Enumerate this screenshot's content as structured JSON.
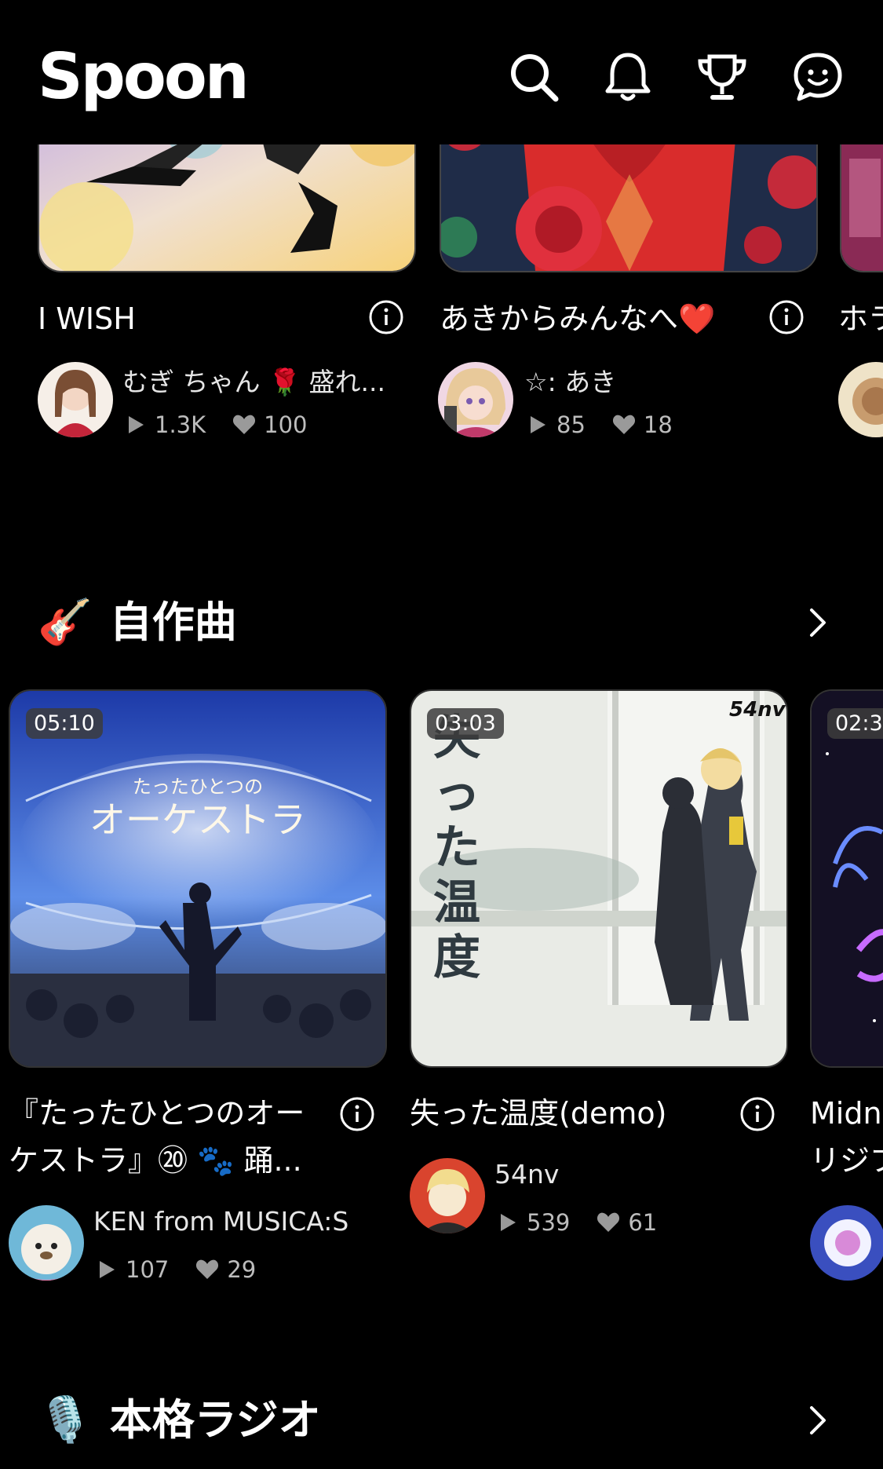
{
  "header": {
    "logo": "Spoon"
  },
  "top_cards": [
    {
      "title": "I WISH",
      "author": "むぎ ちゃん 🌹 盛れ...",
      "plays": "1.3K",
      "likes": "100"
    },
    {
      "title": "あきからみんなへ❤️",
      "author": "☆: あき",
      "plays": "85",
      "likes": "18"
    },
    {
      "title": "ホラ"
    }
  ],
  "sections": {
    "songs": {
      "emoji": "🎸",
      "title": "自作曲"
    },
    "radio": {
      "emoji": "🎙️",
      "title": "本格ラジオ"
    }
  },
  "songs": [
    {
      "duration": "05:10",
      "title_line1": "『たったひとつのオー",
      "title_line2": "ケストラ』⑳ 🐾 踊...",
      "author": "KEN from MUSICA:S",
      "plays": "107",
      "likes": "29",
      "art_title": "たったひとつのオーケストラ"
    },
    {
      "duration": "03:03",
      "title_line1": "失った温度(demo)",
      "author": "54nv",
      "plays": "539",
      "likes": "61",
      "art_title": "失った温度",
      "art_brand": "54nv"
    },
    {
      "duration": "02:3",
      "title_line1": "Midn",
      "title_line2": "リジブ"
    }
  ]
}
